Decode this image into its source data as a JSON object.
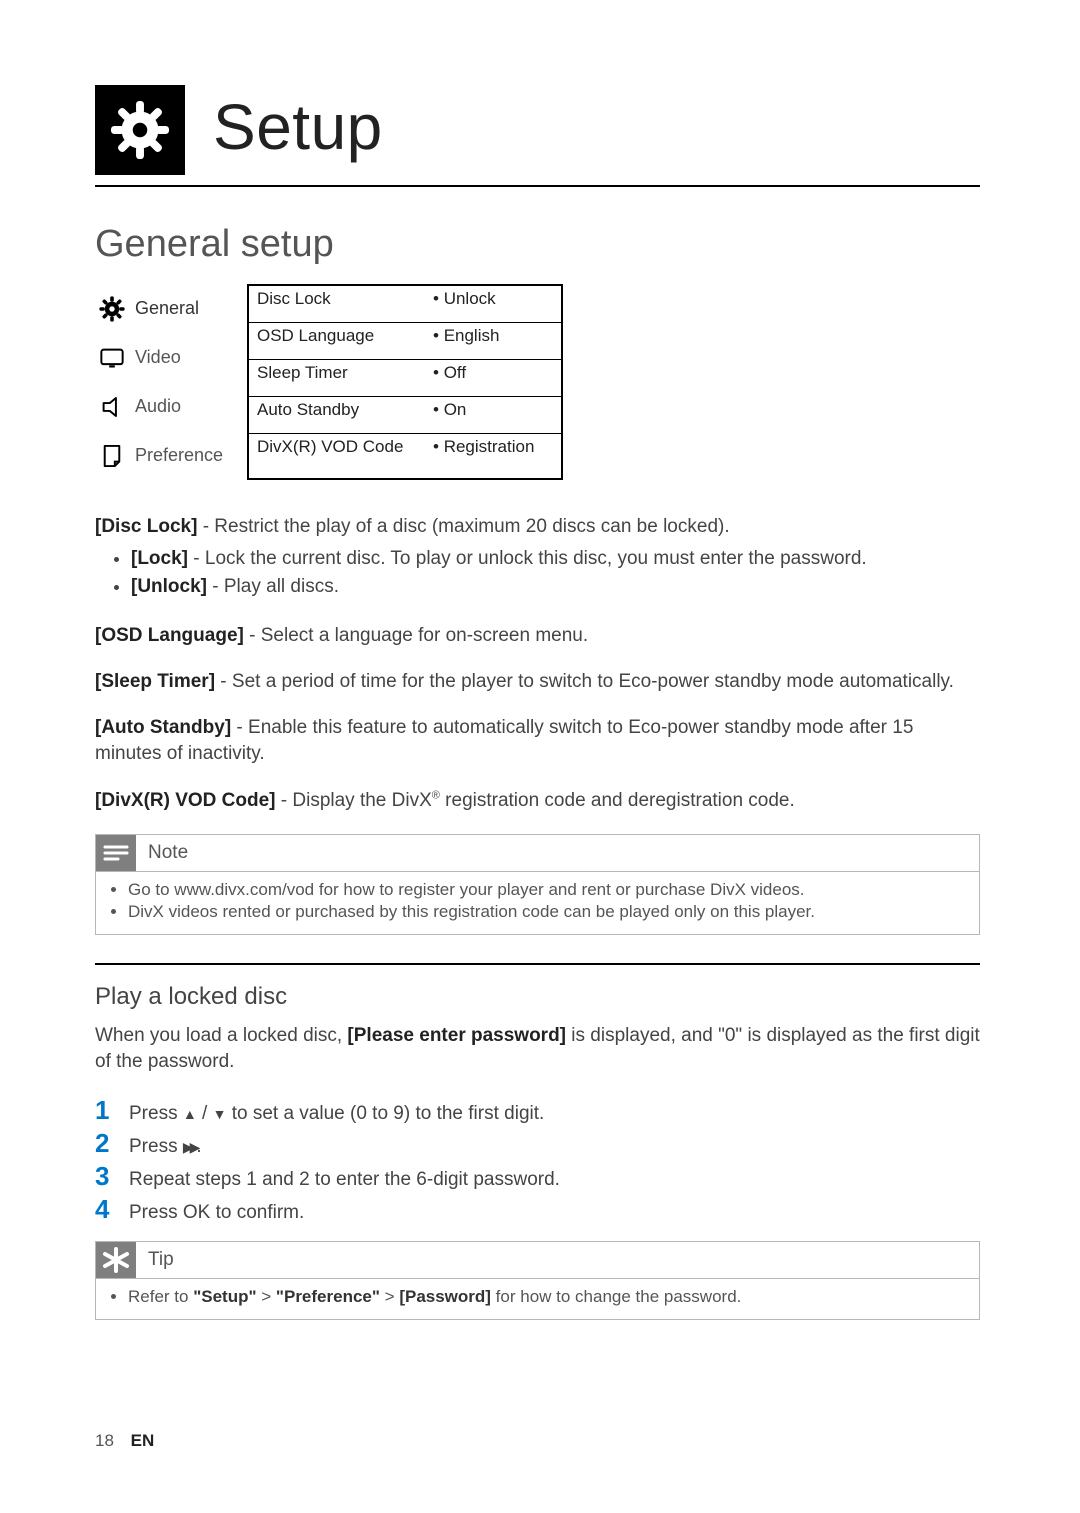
{
  "header": {
    "title": "Setup"
  },
  "section": {
    "title": "General setup"
  },
  "menu": {
    "tabs": [
      {
        "label": "General",
        "icon": "gear",
        "selected": true
      },
      {
        "label": "Video",
        "icon": "screen",
        "selected": false
      },
      {
        "label": "Audio",
        "icon": "speaker",
        "selected": false
      },
      {
        "label": "Preference",
        "icon": "note",
        "selected": false
      }
    ],
    "rows": [
      {
        "option": "Disc Lock",
        "value": "Unlock"
      },
      {
        "option": "OSD Language",
        "value": "English"
      },
      {
        "option": "Sleep Timer",
        "value": "Off"
      },
      {
        "option": "Auto Standby",
        "value": "On"
      },
      {
        "option": "DivX(R) VOD Code",
        "value": "Registration"
      }
    ]
  },
  "defs": {
    "disc_lock": {
      "term": "[Disc Lock]",
      "desc": " - Restrict the play of a disc (maximum 20 discs can be locked).",
      "sub": [
        {
          "term": "[Lock]",
          "desc": " - Lock the current disc. To play or unlock this disc, you must enter the password."
        },
        {
          "term": "[Unlock]",
          "desc": " - Play all discs."
        }
      ]
    },
    "osd_language": {
      "term": "[OSD Language]",
      "desc": " - Select a language for on-screen menu."
    },
    "sleep_timer": {
      "term": "[Sleep Timer]",
      "desc": " - Set a period of time for the player to switch to Eco-power standby mode automatically."
    },
    "auto_standby": {
      "term": "[Auto Standby]",
      "desc": " - Enable this feature to automatically switch to Eco-power standby mode after 15 minutes of inactivity."
    },
    "divx": {
      "term": "[DivX(R) VOD Code]",
      "desc_pre": " - Display the DivX",
      "desc_post": " registration code and deregistration code."
    }
  },
  "note": {
    "title": "Note",
    "items": [
      "Go to www.divx.com/vod for how to register your player and rent or purchase DivX videos.",
      "DivX videos rented or purchased by this registration code can be played only on this player."
    ]
  },
  "play_locked": {
    "title": "Play a locked disc",
    "intro_pre": "When you load a locked disc, ",
    "intro_bold": "[Please enter password]",
    "intro_post": " is displayed, and \"0\" is displayed as the first digit of the password.",
    "steps": {
      "s1_pre": "Press ",
      "s1_post": " to set a value (0 to 9) to the first digit.",
      "s2_pre": "Press ",
      "s2_post": ".",
      "s3": "Repeat steps 1 and 2 to enter the 6-digit password.",
      "s4_pre": "Press ",
      "s4_bold": "OK",
      "s4_post": " to confirm."
    }
  },
  "tip": {
    "title": "Tip",
    "item_pre": "Refer to ",
    "path1": "\"Setup\"",
    "gt1": " > ",
    "path2": "\"Preference\"",
    "gt2": " > ",
    "path3": "[Password]",
    "item_post": " for how to change the password."
  },
  "footer": {
    "page_no": "18",
    "lang": "EN"
  }
}
